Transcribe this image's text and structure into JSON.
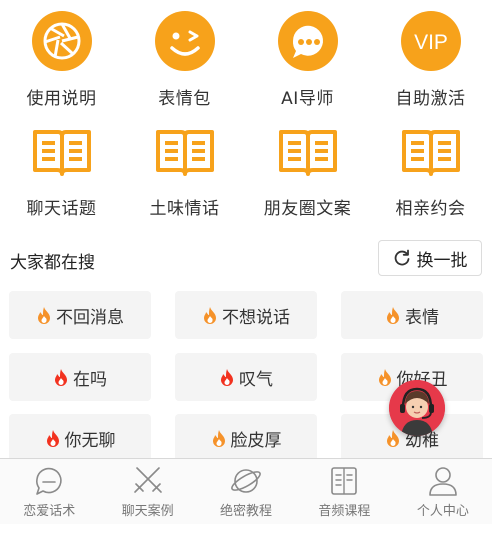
{
  "colors": {
    "accent": "#f7a21b",
    "fire_red": "#f2321f",
    "fire_orange": "#f5922a",
    "assistant_bg": "#e6394a"
  },
  "tools_row1": [
    {
      "icon": "aperture-icon",
      "label": "使用说明"
    },
    {
      "icon": "wink-face-icon",
      "label": "表情包"
    },
    {
      "icon": "ai-chat-icon",
      "label": "AI导师"
    },
    {
      "icon": "vip-icon",
      "label": "自助激活",
      "badge": "VIP"
    }
  ],
  "tools_row2": [
    {
      "icon": "open-book-icon",
      "label": "聊天话题"
    },
    {
      "icon": "open-book-icon",
      "label": "土味情话"
    },
    {
      "icon": "open-book-icon",
      "label": "朋友圈文案"
    },
    {
      "icon": "open-book-icon",
      "label": "相亲约会"
    }
  ],
  "search": {
    "title": "大家都在搜",
    "refresh_label": "换一批"
  },
  "tags": [
    {
      "text": "不回消息",
      "hot": "orange"
    },
    {
      "text": "不想说话",
      "hot": "orange"
    },
    {
      "text": "表情",
      "hot": "orange"
    },
    {
      "text": "在吗",
      "hot": "red"
    },
    {
      "text": "叹气",
      "hot": "red"
    },
    {
      "text": "你好丑",
      "hot": "orange"
    },
    {
      "text": "你无聊",
      "hot": "red"
    },
    {
      "text": "脸皮厚",
      "hot": "orange"
    },
    {
      "text": "幼稚",
      "hot": "orange"
    }
  ],
  "tabbar": [
    {
      "icon": "chat-bubble-icon",
      "label": "恋爱话术"
    },
    {
      "icon": "crossed-swords-icon",
      "label": "聊天案例"
    },
    {
      "icon": "planet-icon",
      "label": "绝密教程"
    },
    {
      "icon": "document-icon",
      "label": "音频课程"
    },
    {
      "icon": "person-icon",
      "label": "个人中心"
    }
  ]
}
